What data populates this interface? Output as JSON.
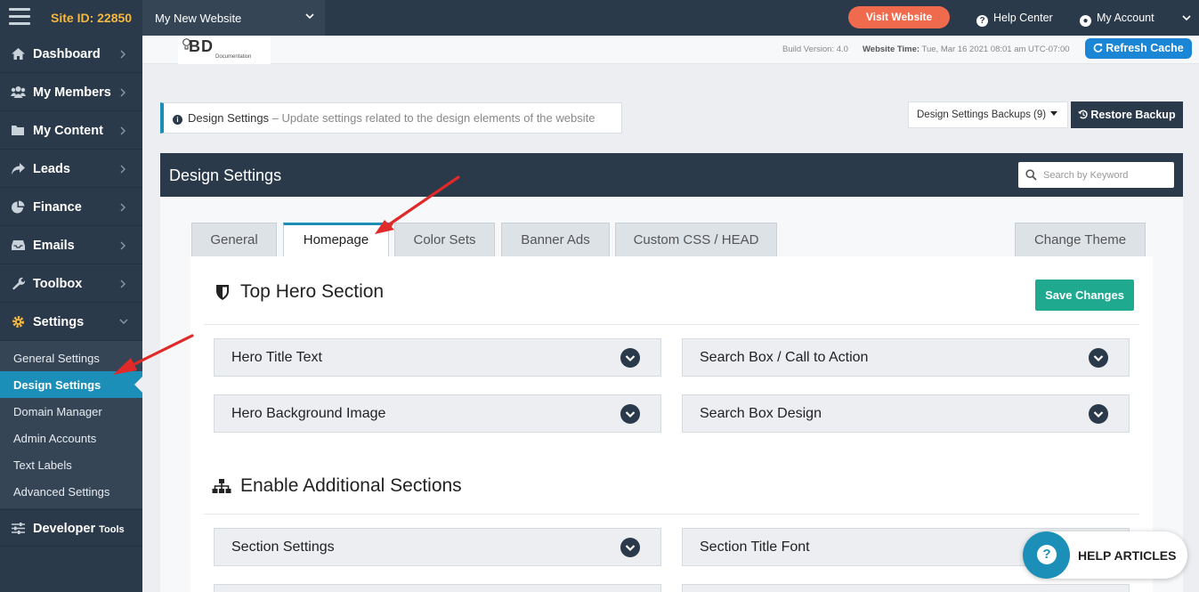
{
  "topbar": {
    "site_id": "Site ID: 22850",
    "site_select": "My New Website",
    "visit_website": "Visit Website",
    "help_center": "Help Center",
    "my_account": "My Account"
  },
  "sidebar": {
    "items": [
      {
        "label": "Dashboard",
        "icon": "home-icon"
      },
      {
        "label": "My Members",
        "icon": "users-icon"
      },
      {
        "label": "My Content",
        "icon": "folder-icon"
      },
      {
        "label": "Leads",
        "icon": "share-icon"
      },
      {
        "label": "Finance",
        "icon": "pie-chart-icon"
      },
      {
        "label": "Emails",
        "icon": "inbox-icon"
      },
      {
        "label": "Toolbox",
        "icon": "wrench-icon"
      },
      {
        "label": "Settings",
        "icon": "gear-icon"
      }
    ],
    "settings_submenu": [
      "General Settings",
      "Design Settings",
      "Domain Manager",
      "Admin Accounts",
      "Text Labels",
      "Advanced Settings"
    ],
    "developer": "Developer",
    "developer_small": "Tools"
  },
  "header": {
    "logo_main": "BD",
    "logo_sub": "Documentation",
    "build_version": "Build Version: 4.0",
    "website_time_label": "Website Time:",
    "website_time_value": "Tue, Mar 16 2021 08:01 am UTC-07:00",
    "refresh_cache": "Refresh Cache"
  },
  "info_bar": {
    "title": "Design Settings",
    "description": " – Update settings related to the design elements of the website"
  },
  "backups": {
    "dropdown": "Design Settings Backups (9)",
    "restore": "Restore Backup"
  },
  "panel": {
    "title": "Design Settings",
    "search_placeholder": "Search by Keyword"
  },
  "tabs": [
    "General",
    "Homepage",
    "Color Sets",
    "Banner Ads",
    "Custom CSS / HEAD",
    "Change Theme"
  ],
  "sections": {
    "hero_title": "Top Hero Section",
    "save_changes": "Save Changes",
    "hero_items": [
      "Hero Title Text",
      "Search Box / Call to Action",
      "Hero Background Image",
      "Search Box Design"
    ],
    "additional_title": "Enable Additional Sections",
    "additional_items": [
      "Section Settings",
      "Section Title Font"
    ]
  },
  "help_articles": "HELP ARTICLES",
  "colors": {
    "sidebar_bg": "#2b3a4a",
    "accent": "#1b8fb8",
    "site_id": "#f5b841",
    "visit_button": "#f06b4d",
    "save_button": "#1faa8f",
    "annotation_arrow": "#e02a2a"
  }
}
